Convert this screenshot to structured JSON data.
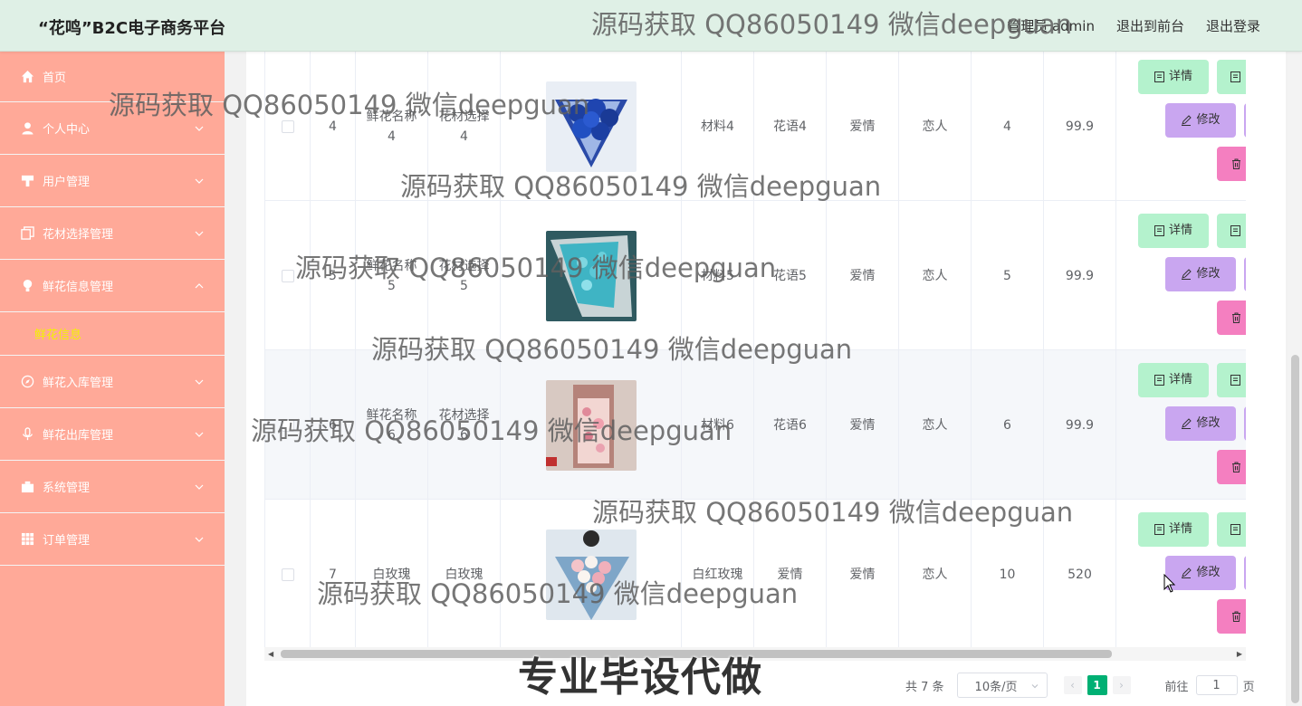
{
  "header": {
    "brand": "“花鸣”B2C电子商务平台",
    "admin_label": "管理员 admin",
    "front_link": "退出到前台",
    "logout_link": "退出登录"
  },
  "sidebar": {
    "items": [
      {
        "label": "首页",
        "icon": "home-icon"
      },
      {
        "label": "个人中心",
        "icon": "user-icon"
      },
      {
        "label": "用户管理",
        "icon": "desk-icon"
      },
      {
        "label": "花材选择管理",
        "icon": "copy-icon"
      },
      {
        "label": "鲜花信息管理",
        "icon": "bulb-icon"
      },
      {
        "label": "鲜花入库管理",
        "icon": "compass-icon"
      },
      {
        "label": "鲜花出库管理",
        "icon": "mic-icon"
      },
      {
        "label": "系统管理",
        "icon": "camera-icon"
      },
      {
        "label": "订单管理",
        "icon": "grid-icon"
      }
    ],
    "submenu": {
      "label": "鲜花信息"
    }
  },
  "rows": [
    {
      "id": "4",
      "name": "鲜花名称\n4",
      "material_select": "花材选择\n4",
      "material": "材料4",
      "language": "花语4",
      "theme": "爱情",
      "target": "恋人",
      "stock": "4",
      "price": "99.9"
    },
    {
      "id": "5",
      "name": "鲜花名称\n5",
      "material_select": "花材选择\n5",
      "material": "材料5",
      "language": "花语5",
      "theme": "爱情",
      "target": "恋人",
      "stock": "5",
      "price": "99.9"
    },
    {
      "id": "6",
      "name": "鲜花名称\n6",
      "material_select": "花材选择\n6",
      "material": "材料6",
      "language": "花语6",
      "theme": "爱情",
      "target": "恋人",
      "stock": "6",
      "price": "99.9"
    },
    {
      "id": "7",
      "name": "白玫瑰",
      "material_select": "白玫瑰",
      "material": "白红玫瑰",
      "language": "爱情",
      "theme": "爱情",
      "target": "恋人",
      "stock": "10",
      "price": "520"
    }
  ],
  "actions": {
    "detail": "详情",
    "edit": "修改"
  },
  "pagination": {
    "total": "共 7 条",
    "page_size": "10条/页",
    "current_page": "1",
    "goto_label": "前往",
    "goto_value": "1",
    "page_unit": "页"
  },
  "watermarks": {
    "text": "源码获取 QQ86050149 微信deepguan",
    "banner": "专业毕设代做"
  },
  "colors": {
    "sidebar": "#ffa998",
    "header": "#dff0e6",
    "detail_button": "#b4f2cd",
    "edit_button": "#c9a6f0",
    "delete_button": "#f47fc0",
    "active_submenu": "#f3f300",
    "pager_active": "#00b073"
  }
}
